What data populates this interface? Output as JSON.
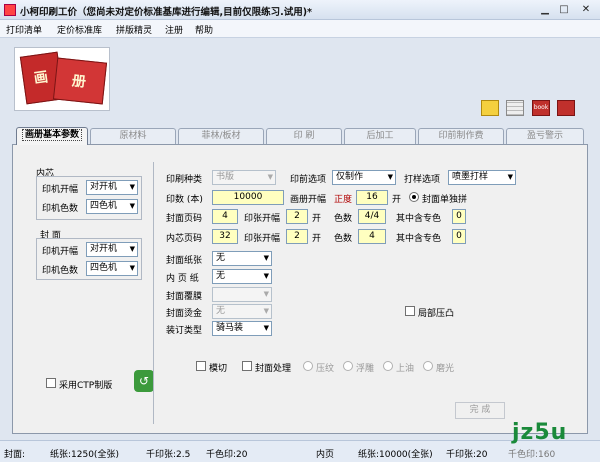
{
  "window": {
    "title": "小柯印刷工价（您尚未对定价标准基库进行编辑,目前仅限练习.试用)*",
    "min_icon": "minimize-icon",
    "max_icon": "maximize-icon",
    "close_icon": "close-icon"
  },
  "menu": [
    "打印清单",
    "定价标准库",
    "拼版精灵",
    "注册",
    "帮助"
  ],
  "toolbar": {
    "thumb_chars": [
      "画",
      "册"
    ],
    "icons": [
      "star-check-icon",
      "grid-icon",
      "book-icon",
      "search-icon"
    ],
    "book_icon_text": "book"
  },
  "tabs": [
    "画册基本参数",
    "原材料",
    "菲林/板材",
    "印 刷",
    "后加工",
    "印前制作费",
    "盈亏警示"
  ],
  "left": {
    "inner_title": "内芯",
    "cover_title": "封 面",
    "inner_kaifu_label": "印机开幅",
    "inner_kaifu_value": "对开机",
    "inner_color_label": "印机色数",
    "inner_color_value": "四色机",
    "cover_kaifu_label": "印机开幅",
    "cover_kaifu_value": "对开机",
    "cover_color_label": "印机色数",
    "cover_color_value": "四色机",
    "ctp_label": "采用CTP制版"
  },
  "form": {
    "print_type_label": "印刷种类",
    "print_type_value": "书版",
    "prepress_label": "印前选项",
    "prepress_value": "仅制作",
    "proof_label": "打样选项",
    "proof_value": "喷墨打样",
    "qty_label": "印数 (本)",
    "qty_value": "10000",
    "album_size_label": "画册开幅",
    "album_size_type": "正度",
    "album_size_value": "16",
    "album_size_unit": "开",
    "single_cover_label": "封面单独拼",
    "cover_pages_label": "封面页码",
    "cover_pages_value": "4",
    "cover_sheet_label": "印张开幅",
    "cover_sheet_value": "2",
    "cover_sheet_unit": "开",
    "cover_colors_label": "色数",
    "cover_colors_value": "4/4",
    "cover_spot_label": "其中含专色",
    "cover_spot_value": "0",
    "inner_pages_label": "内芯页码",
    "inner_pages_value": "32",
    "inner_sheet_label": "印张开幅",
    "inner_sheet_value": "2",
    "inner_sheet_unit": "开",
    "inner_colors_label": "色数",
    "inner_colors_value": "4",
    "inner_spot_label": "其中含专色",
    "inner_spot_value": "0",
    "cover_paper_label": "封面纸张",
    "cover_paper_value": "无",
    "inner_paper_label": "内 页 纸",
    "inner_paper_value": "无",
    "cover_film_label": "封面覆膜",
    "cover_film_value": "",
    "cover_foil_label": "封面烫金",
    "cover_foil_value": "无",
    "binding_label": "装订类型",
    "binding_value": "骑马装",
    "partial_emboss_label": "局部压凸",
    "die_cut_label": "模切",
    "cover_treat_label": "封面处理",
    "treat_options": [
      "压纹",
      "浮雕",
      "上油",
      "磨光"
    ],
    "finish_button": "完 成"
  },
  "status": {
    "cover_label": "封面:",
    "cover_paper": "纸张:1250(全张)",
    "cover_kilo": "千印张:2.5",
    "cover_color_kilo": "千色印:20",
    "inner_label": "内页",
    "inner_paper": "纸张:10000(全张)",
    "inner_kilo": "千印张:20",
    "inner_color_kilo": "千色印:160"
  },
  "watermark": "jz5u",
  "colors": {
    "accent_red": "#c42a2a",
    "yellow_input": "#ffffc0",
    "panel_bg": "#f0f0f0"
  }
}
